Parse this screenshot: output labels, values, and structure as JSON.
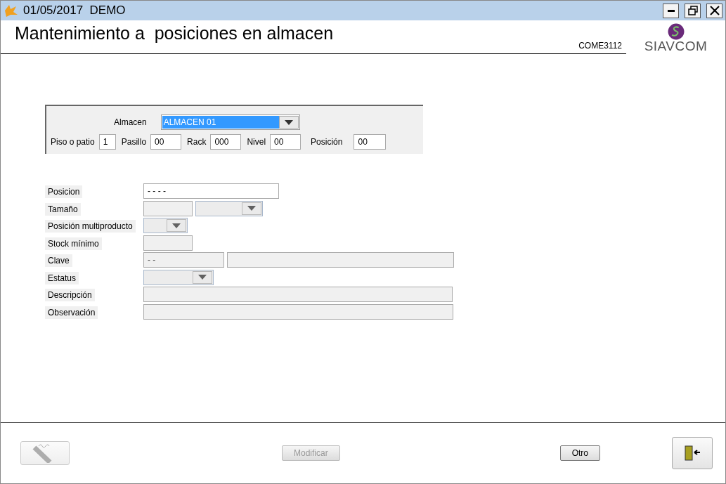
{
  "window": {
    "title": "01/05/2017  DEMO"
  },
  "header": {
    "title": "Mantenimiento a  posiciones en almacen",
    "code": "COME3112",
    "logo_text": "SIAVCOM"
  },
  "filter": {
    "almacen_label": "Almacen",
    "almacen_value": "ALMACEN 01",
    "fields": [
      {
        "label": "Piso o patio",
        "value": "1"
      },
      {
        "label": "Pasillo",
        "value": "00"
      },
      {
        "label": "Rack",
        "value": "000"
      },
      {
        "label": "Nivel",
        "value": "00"
      },
      {
        "label": "Posición",
        "value": "00"
      }
    ]
  },
  "form": {
    "rows": [
      {
        "label": "Posicion",
        "controls": [
          {
            "kind": "field",
            "value": "- - - -",
            "disabled": false
          }
        ]
      },
      {
        "label": "Tamaño",
        "controls": [
          {
            "kind": "field",
            "disabled": true
          },
          {
            "kind": "combo",
            "disabled": true
          }
        ]
      },
      {
        "label": "Posición multiproducto",
        "controls": [
          {
            "kind": "combo",
            "disabled": true
          }
        ]
      },
      {
        "label": "Stock mínimo",
        "controls": [
          {
            "kind": "field",
            "disabled": true
          }
        ]
      },
      {
        "label": "Clave",
        "controls": [
          {
            "kind": "field",
            "value": "- -",
            "disabled": true
          },
          {
            "kind": "field",
            "disabled": true
          }
        ]
      },
      {
        "label": "Estatus",
        "controls": [
          {
            "kind": "combo",
            "disabled": true
          }
        ]
      },
      {
        "label": "Descripción",
        "controls": [
          {
            "kind": "field",
            "disabled": true
          }
        ]
      },
      {
        "label": "Observación",
        "controls": [
          {
            "kind": "field",
            "disabled": true
          }
        ]
      }
    ]
  },
  "footer": {
    "buttons": [
      {
        "kind": "icon-edit",
        "disabled": true
      },
      {
        "kind": "text",
        "label": "Modificar",
        "disabled": true
      },
      {
        "kind": "text",
        "label": "Otro",
        "disabled": false
      },
      {
        "kind": "icon-exit",
        "disabled": false
      }
    ]
  }
}
